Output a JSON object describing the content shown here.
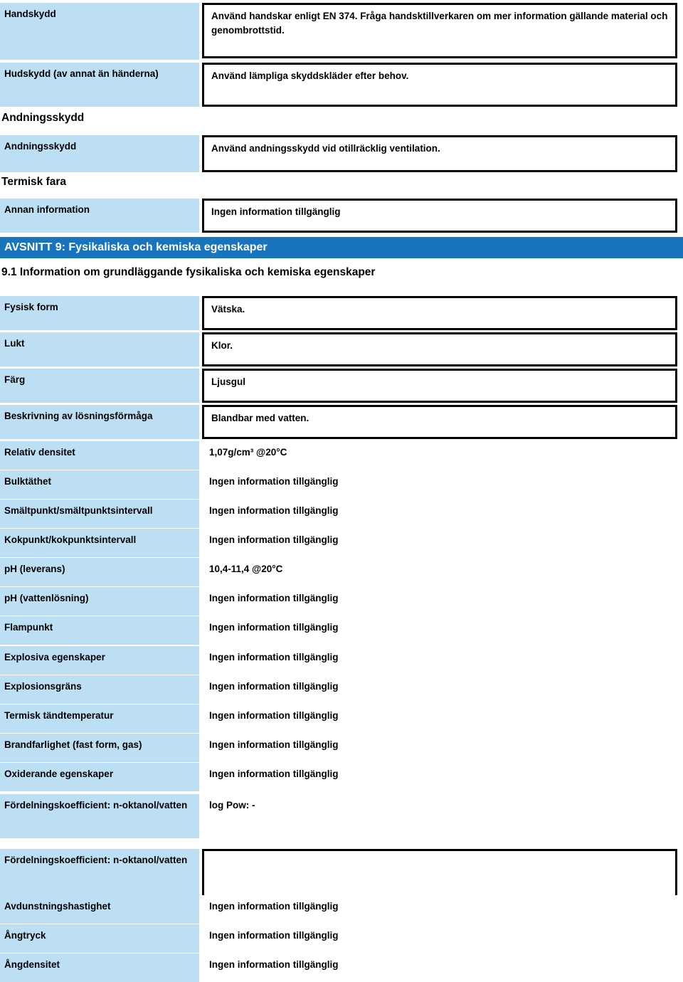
{
  "document": {
    "language": "sv",
    "type": "safety-data-sheet",
    "colors": {
      "section_bar_bg": "#1874bc",
      "section_bar_text": "#ffffff",
      "label_bg": "#bcdff4",
      "value_border": "#000000",
      "page_bg": "#ffffff"
    }
  },
  "no_info_text": "Ingen information tillgänglig",
  "ppe_section": {
    "rows": [
      {
        "label": "Handskydd",
        "value": "Använd handskar enligt EN 374. Fråga handsktillverkaren om mer information gällande material och genombrottstid.",
        "boxed": true
      },
      {
        "label": "Hudskydd (av annat än händerna)",
        "value": "Använd lämpliga skyddskläder efter behov.",
        "boxed": true
      }
    ],
    "subheading_respiratory": "Andningsskydd",
    "respiratory_row": {
      "label": "Andningsskydd",
      "value": "Använd andningsskydd vid otillräcklig ventilation.",
      "boxed": true
    },
    "subheading_thermal": "Termisk fara",
    "other_info_row": {
      "label": "Annan information",
      "value": "Ingen information tillgänglig",
      "boxed": true
    }
  },
  "section9": {
    "bar_title": "AVSNITT 9: Fysikaliska och kemiska egenskaper",
    "subsection_title": "9.1 Information om grundläggande fysikaliska och kemiska egenskaper",
    "boxed_rows": [
      {
        "label": "Fysisk form",
        "value": "Vätska."
      },
      {
        "label": "Lukt",
        "value": "Klor."
      },
      {
        "label": "Färg",
        "value": "Ljusgul"
      },
      {
        "label": "Beskrivning av lösningsförmåga",
        "value": "Blandbar med vatten."
      }
    ],
    "plain_rows": [
      {
        "label": "Relativ densitet",
        "value": "1,07g/cm³ @20°C"
      },
      {
        "label": "Bulktäthet",
        "value": "Ingen information tillgänglig"
      },
      {
        "label": "Smältpunkt/smältpunktsintervall",
        "value": "Ingen information tillgänglig"
      },
      {
        "label": "Kokpunkt/kokpunktsintervall",
        "value": "Ingen information tillgänglig"
      },
      {
        "label": "pH (leverans)",
        "value": "10,4-11,4 @20°C"
      },
      {
        "label": "pH (vattenlösning)",
        "value": "Ingen information tillgänglig"
      },
      {
        "label": "Flampunkt",
        "value": "Ingen information tillgänglig"
      },
      {
        "label": "Explosiva egenskaper",
        "value": "Ingen information tillgänglig"
      },
      {
        "label": "Explosionsgräns",
        "value": "Ingen information tillgänglig"
      },
      {
        "label": "Termisk tändtemperatur",
        "value": "Ingen information tillgänglig"
      },
      {
        "label": "Brandfarlighet (fast form, gas)",
        "value": "Ingen information tillgänglig"
      },
      {
        "label": "Oxiderande egenskaper",
        "value": "Ingen information tillgänglig"
      },
      {
        "label": "Fördelningskoefficient: n-oktanol/vatten",
        "value": "log Pow:     -"
      }
    ],
    "partition_empty_row": {
      "label": "Fördelningskoefficient: n-oktanol/vatten",
      "value": ""
    },
    "tail_rows": [
      {
        "label": "Avdunstningshastighet",
        "value": "Ingen information tillgänglig"
      },
      {
        "label": "Ångtryck",
        "value": "Ingen information tillgänglig"
      },
      {
        "label": "Ångdensitet",
        "value": "Ingen information tillgänglig"
      }
    ]
  }
}
